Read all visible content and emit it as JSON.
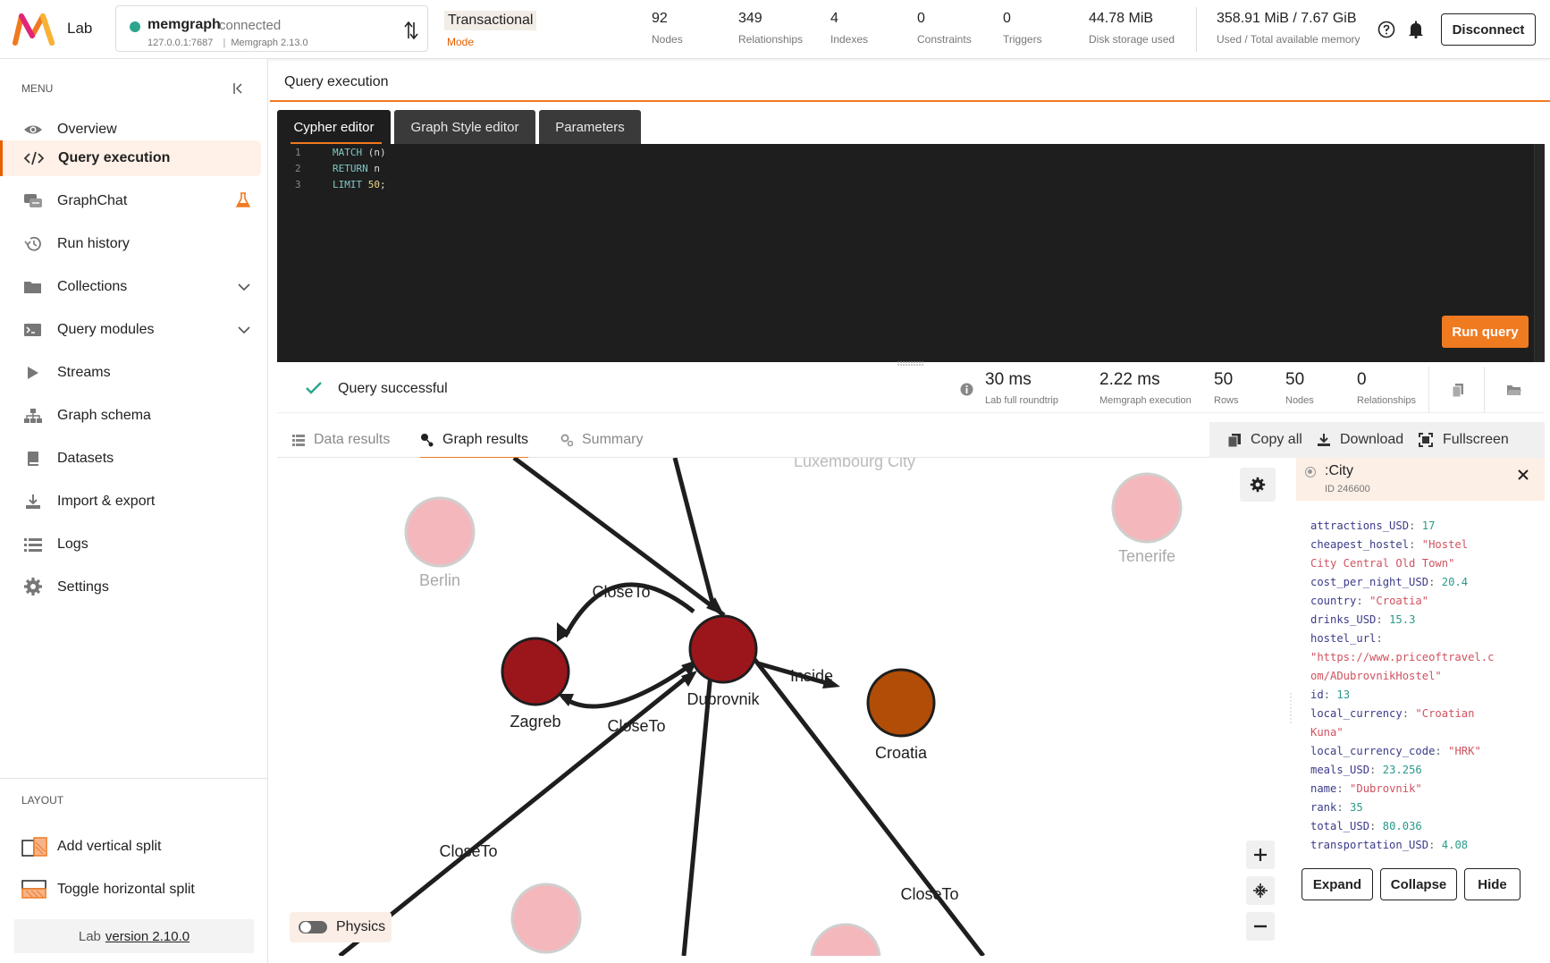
{
  "app": {
    "name": "Lab"
  },
  "connection": {
    "name": "memgraph",
    "status": "connected",
    "address": "127.0.0.1:7687",
    "version": "Memgraph 2.13.0",
    "status_color": "#2ba68c"
  },
  "mode": {
    "value": "Transactional",
    "label": "Mode"
  },
  "stats": [
    {
      "value": "92",
      "label": "Nodes"
    },
    {
      "value": "349",
      "label": "Relationships"
    },
    {
      "value": "4",
      "label": "Indexes"
    },
    {
      "value": "0",
      "label": "Constraints"
    },
    {
      "value": "0",
      "label": "Triggers"
    },
    {
      "value": "44.78 MiB",
      "label": "Disk storage used"
    }
  ],
  "memory": {
    "value": "358.91 MiB / 7.67 GiB",
    "label": "Used / Total available memory"
  },
  "header_buttons": {
    "disconnect": "Disconnect"
  },
  "sidebar": {
    "menu_title": "MENU",
    "items": [
      {
        "label": "Overview",
        "icon": "eye-icon"
      },
      {
        "label": "Query execution",
        "icon": "code-icon"
      },
      {
        "label": "GraphChat",
        "icon": "chat-icon"
      },
      {
        "label": "Run history",
        "icon": "history-icon"
      },
      {
        "label": "Collections",
        "icon": "folder-icon"
      },
      {
        "label": "Query modules",
        "icon": "terminal-icon"
      },
      {
        "label": "Streams",
        "icon": "play-icon"
      },
      {
        "label": "Graph schema",
        "icon": "schema-icon"
      },
      {
        "label": "Datasets",
        "icon": "book-icon"
      },
      {
        "label": "Import & export",
        "icon": "download-icon"
      },
      {
        "label": "Logs",
        "icon": "list-icon"
      },
      {
        "label": "Settings",
        "icon": "gear-icon"
      }
    ],
    "layout_title": "LAYOUT",
    "layout_items": [
      {
        "label": "Add vertical split",
        "icon": "vertical-split-icon"
      },
      {
        "label": "Toggle horizontal split",
        "icon": "horizontal-split-icon"
      }
    ],
    "version_prefix": "Lab",
    "version_link": "version 2.10.0"
  },
  "main": {
    "title": "Query execution",
    "editor_tabs": [
      "Cypher editor",
      "Graph Style editor",
      "Parameters"
    ],
    "code_lines": [
      {
        "num": "1",
        "kw": "MATCH",
        "rest": " (n)"
      },
      {
        "num": "2",
        "kw": "RETURN",
        "rest": " n"
      },
      {
        "num": "3",
        "kw": "LIMIT",
        "rest": " ",
        "n": "50",
        "tail": ";"
      }
    ],
    "run_button": "Run query"
  },
  "status": {
    "text": "Query successful",
    "metrics": [
      {
        "value": "30 ms",
        "label": "Lab full roundtrip"
      },
      {
        "value": "2.22 ms",
        "label": "Memgraph execution"
      },
      {
        "value": "50",
        "label": "Rows"
      },
      {
        "value": "50",
        "label": "Nodes"
      },
      {
        "value": "0",
        "label": "Relationships"
      }
    ]
  },
  "results": {
    "tabs": [
      "Data results",
      "Graph results",
      "Summary"
    ],
    "tools": [
      "Copy all",
      "Download",
      "Fullscreen"
    ],
    "physics_label": "Physics"
  },
  "graph": {
    "nodes": [
      {
        "label": "Berlin",
        "color": "#f4b8bc"
      },
      {
        "label": "Tenerife",
        "color": "#f4b8bc"
      },
      {
        "label": "Zagreb",
        "color": "#9b161b"
      },
      {
        "label": "Dubrovnik",
        "color": "#9b161b"
      },
      {
        "label": "Croatia",
        "color": "#b14d07"
      },
      {
        "label": "Luxembourg City",
        "color": "#f4b8bc"
      }
    ],
    "edge_labels": [
      "CloseTo",
      "CloseTo",
      "Inside",
      "CloseTo",
      "CloseTo"
    ]
  },
  "properties": {
    "label": ":City",
    "id": "ID 246600",
    "rows": [
      {
        "key": "attractions_USD",
        "value": "17",
        "type": "num"
      },
      {
        "key": "cheapest_hostel",
        "value": "\"Hostel",
        "type": "str"
      },
      {
        "key": "",
        "value": "City Central Old Town\"",
        "type": "str"
      },
      {
        "key": "cost_per_night_USD",
        "value": "20.4",
        "type": "num"
      },
      {
        "key": "country",
        "value": "\"Croatia\"",
        "type": "str"
      },
      {
        "key": "drinks_USD",
        "value": "15.3",
        "type": "num"
      },
      {
        "key": "hostel_url",
        "value": "",
        "type": "str"
      },
      {
        "key": "",
        "value": "\"https://www.priceoftravel.c",
        "type": "str"
      },
      {
        "key": "",
        "value": "om/ADubrovnikHostel\"",
        "type": "str"
      },
      {
        "key": "id",
        "value": "13",
        "type": "num"
      },
      {
        "key": "local_currency",
        "value": "\"Croatian",
        "type": "str"
      },
      {
        "key": "",
        "value": "Kuna\"",
        "type": "str"
      },
      {
        "key": "local_currency_code",
        "value": "\"HRK\"",
        "type": "str"
      },
      {
        "key": "meals_USD",
        "value": "23.256",
        "type": "num"
      },
      {
        "key": "name",
        "value": "\"Dubrovnik\"",
        "type": "str"
      },
      {
        "key": "rank",
        "value": "35",
        "type": "num"
      },
      {
        "key": "total_USD",
        "value": "80.036",
        "type": "num"
      },
      {
        "key": "transportation_USD",
        "value": "4.08",
        "type": "num"
      }
    ],
    "buttons": [
      "Expand",
      "Collapse",
      "Hide"
    ]
  },
  "colors": {
    "accent": "#f07a20",
    "editor_bg": "#1e1e1e"
  }
}
